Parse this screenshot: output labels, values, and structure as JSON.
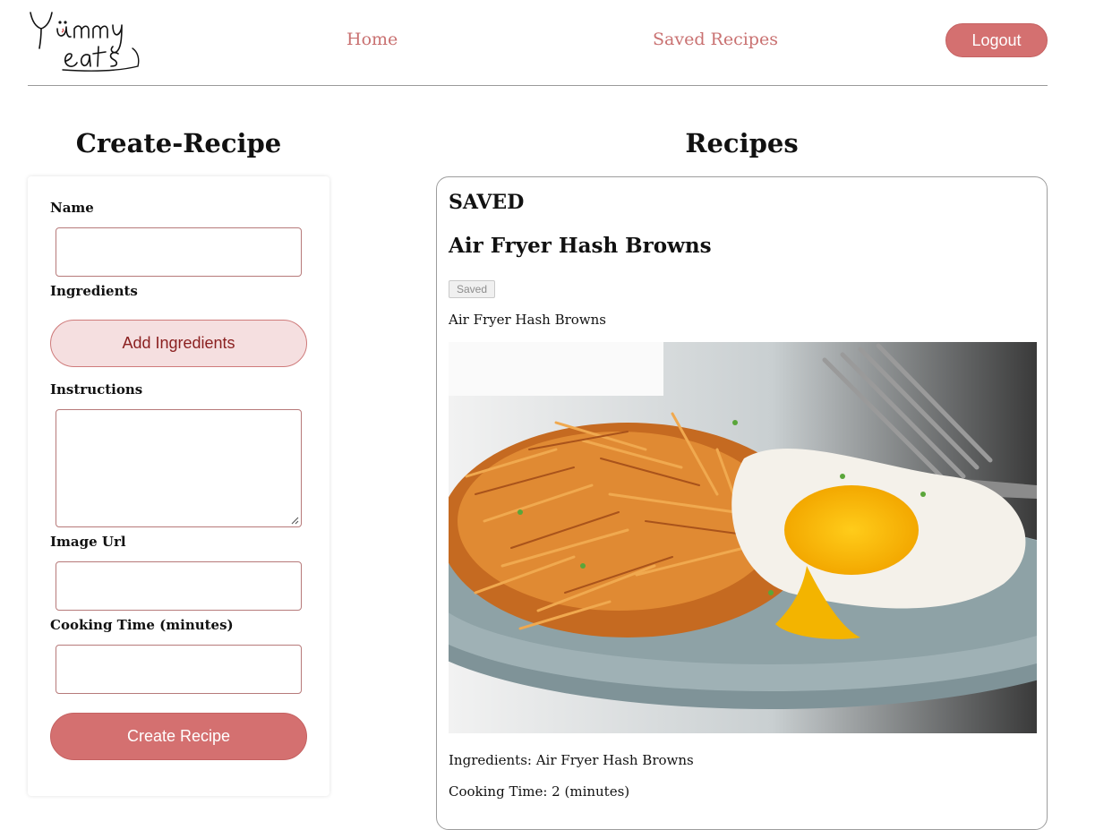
{
  "header": {
    "logo_text_top": "Yummy",
    "logo_text_bottom": "eats",
    "nav": {
      "home": "Home",
      "saved": "Saved Recipes"
    },
    "logout_label": "Logout"
  },
  "create_form": {
    "title": "Create-Recipe",
    "fields": {
      "name": {
        "label": "Name",
        "value": ""
      },
      "ingredients": {
        "label": "Ingredients",
        "button_label": "Add Ingredients"
      },
      "instructions": {
        "label": "Instructions",
        "value": ""
      },
      "image_url": {
        "label": "Image Url",
        "value": ""
      },
      "cooking_time": {
        "label": "Cooking Time (minutes)",
        "value": ""
      }
    },
    "submit_label": "Create Recipe"
  },
  "recipes": {
    "title": "Recipes",
    "section_heading": "SAVED",
    "items": [
      {
        "name": "Air Fryer Hash Browns",
        "badge": "Saved",
        "description": "Air Fryer Hash Browns",
        "ingredients_text": "Ingredients: Air Fryer Hash Browns",
        "cooking_time_text": "Cooking Time: 2 (minutes)"
      }
    ]
  },
  "colors": {
    "accent": "#d47070",
    "nav_link": "#c97171",
    "add_button_bg": "#f5dfe0",
    "add_button_text": "#8a1f1f",
    "input_border": "#b77a7a"
  },
  "icons": {
    "logo": "yummy-eats-logo",
    "textarea_grip": "resize-grip-icon"
  }
}
